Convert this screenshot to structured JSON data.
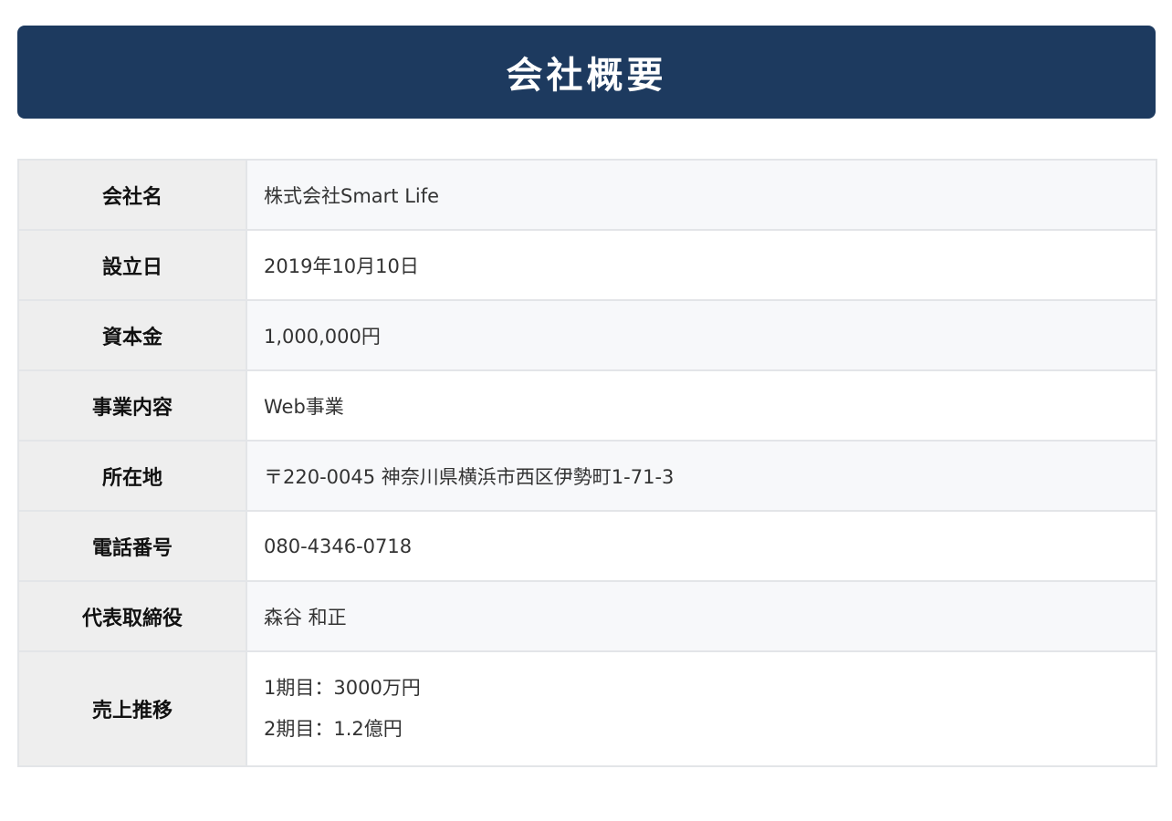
{
  "header": {
    "title": "会社概要"
  },
  "company_info": {
    "rows": [
      {
        "label": "会社名",
        "value": "株式会社Smart Life"
      },
      {
        "label": "設立日",
        "value": "2019年10月10日"
      },
      {
        "label": "資本金",
        "value": "1,000,000円"
      },
      {
        "label": "事業内容",
        "value": "Web事業"
      },
      {
        "label": "所在地",
        "value": "〒220-0045 神奈川県横浜市西区伊勢町1-71-3"
      },
      {
        "label": "電話番号",
        "value": "080-4346-0718"
      },
      {
        "label": "代表取締役",
        "value": "森谷 和正"
      },
      {
        "label": "売上推移",
        "values": [
          "1期目：3000万円",
          "2期目：1.2億円"
        ]
      }
    ]
  },
  "colors": {
    "header_background": "#1d3a5f",
    "header_text": "#ffffff",
    "label_cell_background": "#eeeeee",
    "value_cell_background_striped": "#f7f8fa",
    "border": "#e3e5e8"
  }
}
